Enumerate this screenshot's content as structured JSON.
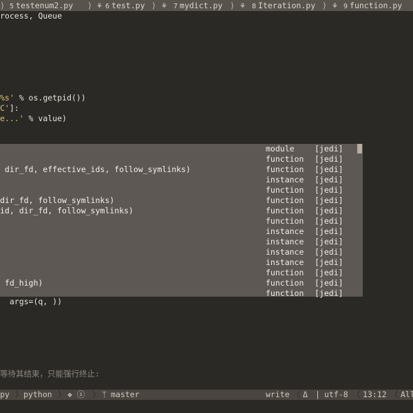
{
  "tabs": [
    {
      "icon": "5",
      "label": "testenum2.py"
    },
    {
      "icon": "6",
      "label": "test.py"
    },
    {
      "icon": "7",
      "label": "mydict.py"
    },
    {
      "icon": "8",
      "label": "Iteration.py"
    },
    {
      "icon": "9",
      "label": "function.py"
    }
  ],
  "code": {
    "line1": "rocess, Queue",
    "line2a": "%s'",
    "line2b": " % os.getpid())",
    "line3a": "C'",
    "line3b": "]:",
    "line4a": "e...'",
    "line4b": " % value)",
    "line5": "  args=(q, ))",
    "line6": "等待其结束，只能强行终止:"
  },
  "completion": {
    "items": [
      {
        "text": "",
        "kind": "module",
        "source": "[jedi]"
      },
      {
        "text": "",
        "kind": "function",
        "source": "[jedi]"
      },
      {
        "text": " dir_fd, effective_ids, follow_symlinks)",
        "kind": "function",
        "source": "[jedi]"
      },
      {
        "text": "",
        "kind": "instance",
        "source": "[jedi]"
      },
      {
        "text": "",
        "kind": "function",
        "source": "[jedi]"
      },
      {
        "text": "dir_fd, follow_symlinks)",
        "kind": "function",
        "source": "[jedi]"
      },
      {
        "text": "id, dir_fd, follow_symlinks)",
        "kind": "function",
        "source": "[jedi]"
      },
      {
        "text": "",
        "kind": "function",
        "source": "[jedi]"
      },
      {
        "text": "",
        "kind": "instance",
        "source": "[jedi]"
      },
      {
        "text": "",
        "kind": "instance",
        "source": "[jedi]"
      },
      {
        "text": "",
        "kind": "instance",
        "source": "[jedi]"
      },
      {
        "text": "",
        "kind": "instance",
        "source": "[jedi]"
      },
      {
        "text": "",
        "kind": "function",
        "source": "[jedi]"
      },
      {
        "text": " fd_high)",
        "kind": "function",
        "source": "[jedi]"
      },
      {
        "text": "",
        "kind": "function",
        "source": "[jedi]"
      }
    ]
  },
  "status": {
    "ext": "py",
    "lang": "python",
    "icons": "❖ ⓢ",
    "branch_icon": "ᛘ",
    "branch": "master",
    "mode": "write",
    "delta": "Δ",
    "sep": "|",
    "encoding": "utf-8",
    "position": "13:12",
    "extra": "All"
  }
}
